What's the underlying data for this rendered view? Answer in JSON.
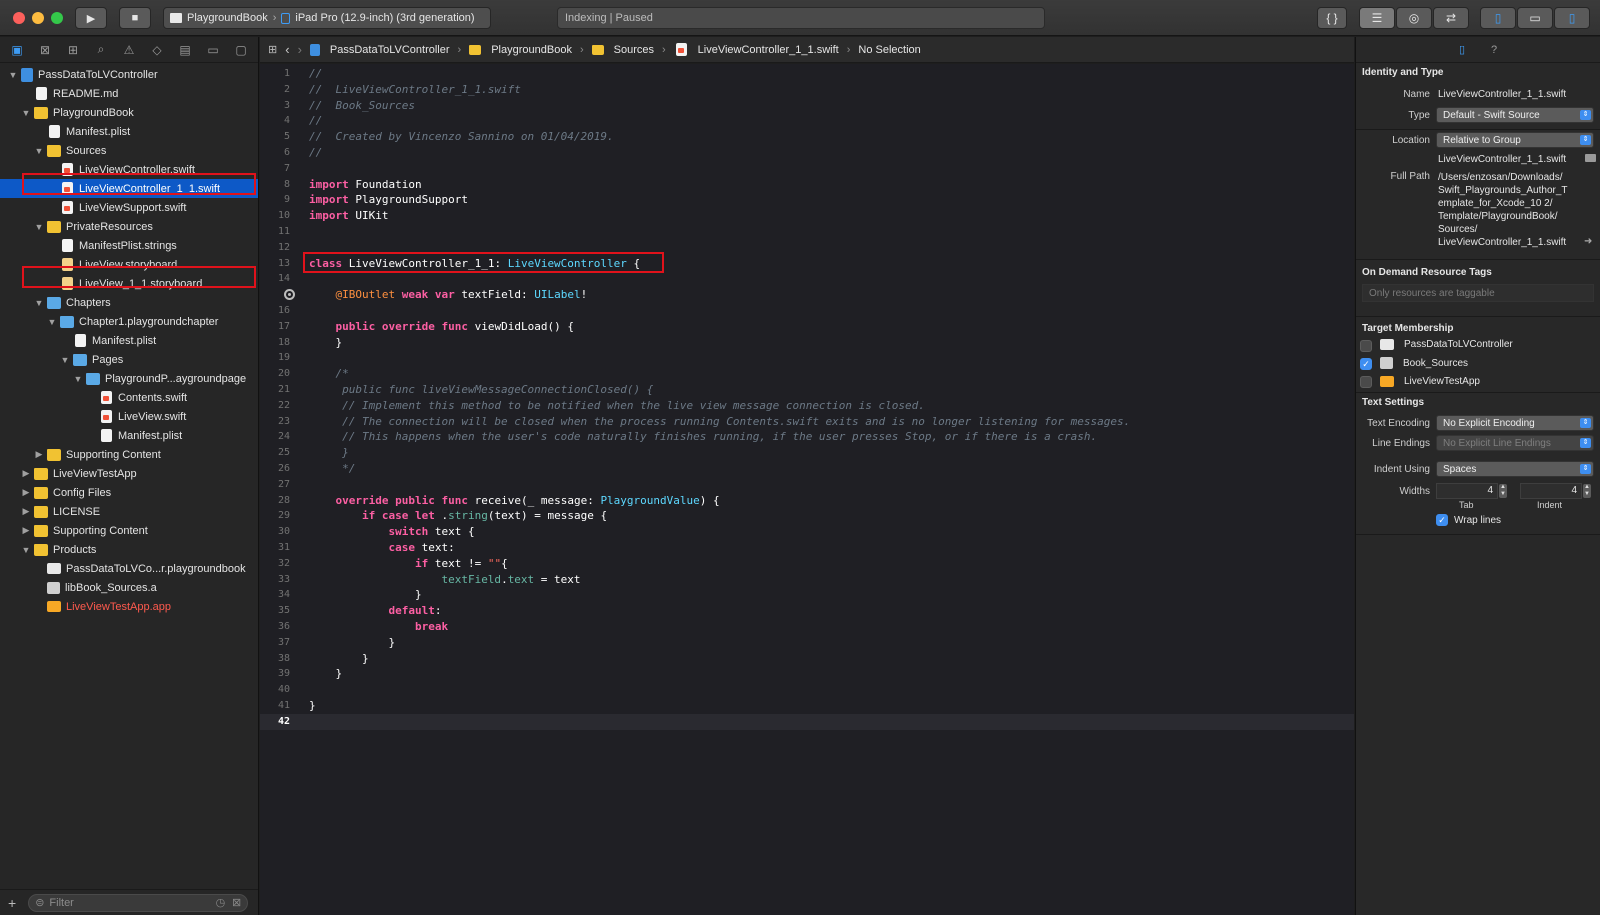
{
  "toolbar": {
    "scheme_name": "PlaygroundBook",
    "device_name": "iPad Pro (12.9-inch) (3rd generation)",
    "activity_status": "Indexing | Paused",
    "icons": [
      "play-icon",
      "stop-icon",
      "braces-icon",
      "standard-editor-icon",
      "assistant-editor-icon",
      "version-editor-icon",
      "left-panel-icon",
      "bottom-panel-icon",
      "right-panel-icon"
    ]
  },
  "navigator": {
    "tabs": [
      "folder-icon",
      "source-control-icon",
      "symbol-icon",
      "search-icon",
      "warning-icon",
      "test-icon",
      "debug-icon",
      "breakpoint-icon",
      "report-icon"
    ],
    "filter_placeholder": "Filter",
    "tree": [
      {
        "label": "PassDataToLVController",
        "depth": 0,
        "icon": "proj",
        "disc": "open"
      },
      {
        "label": "README.md",
        "depth": 1,
        "icon": "file",
        "disc": "none"
      },
      {
        "label": "PlaygroundBook",
        "depth": 1,
        "icon": "folder",
        "disc": "open"
      },
      {
        "label": "Manifest.plist",
        "depth": 2,
        "icon": "file",
        "disc": "none"
      },
      {
        "label": "Sources",
        "depth": 2,
        "icon": "folder",
        "disc": "open"
      },
      {
        "label": "LiveViewController.swift",
        "depth": 3,
        "icon": "swift",
        "disc": "none"
      },
      {
        "label": "LiveViewController_1_1.swift",
        "depth": 3,
        "icon": "swift",
        "disc": "none",
        "selected": true
      },
      {
        "label": "LiveViewSupport.swift",
        "depth": 3,
        "icon": "swift",
        "disc": "none"
      },
      {
        "label": "PrivateResources",
        "depth": 2,
        "icon": "folder",
        "disc": "open"
      },
      {
        "label": "ManifestPlist.strings",
        "depth": 3,
        "icon": "file",
        "disc": "none"
      },
      {
        "label": "LiveView.storyboard",
        "depth": 3,
        "icon": "story",
        "disc": "none"
      },
      {
        "label": "LiveView_1_1.storyboard",
        "depth": 3,
        "icon": "story",
        "disc": "none"
      },
      {
        "label": "Chapters",
        "depth": 2,
        "icon": "bluefolder",
        "disc": "open"
      },
      {
        "label": "Chapter1.playgroundchapter",
        "depth": 3,
        "icon": "bluefolder",
        "disc": "open"
      },
      {
        "label": "Manifest.plist",
        "depth": 4,
        "icon": "file",
        "disc": "none"
      },
      {
        "label": "Pages",
        "depth": 4,
        "icon": "bluefolder",
        "disc": "open"
      },
      {
        "label": "PlaygroundP...aygroundpage",
        "depth": 5,
        "icon": "bluefolder",
        "disc": "open"
      },
      {
        "label": "Contents.swift",
        "depth": 6,
        "icon": "swift",
        "disc": "none"
      },
      {
        "label": "LiveView.swift",
        "depth": 6,
        "icon": "swift",
        "disc": "none"
      },
      {
        "label": "Manifest.plist",
        "depth": 6,
        "icon": "file",
        "disc": "none"
      },
      {
        "label": "Supporting Content",
        "depth": 2,
        "icon": "folder",
        "disc": "closed"
      },
      {
        "label": "LiveViewTestApp",
        "depth": 1,
        "icon": "folder",
        "disc": "closed"
      },
      {
        "label": "Config Files",
        "depth": 1,
        "icon": "folder",
        "disc": "closed"
      },
      {
        "label": "LICENSE",
        "depth": 1,
        "icon": "folder",
        "disc": "closed"
      },
      {
        "label": "Supporting Content",
        "depth": 1,
        "icon": "folder",
        "disc": "closed"
      },
      {
        "label": "Products",
        "depth": 1,
        "icon": "folder",
        "disc": "open"
      },
      {
        "label": "PassDataToLVCo...r.playgroundbook",
        "depth": 2,
        "icon": "book",
        "disc": "none"
      },
      {
        "label": "libBook_Sources.a",
        "depth": 2,
        "icon": "lib",
        "disc": "none"
      },
      {
        "label": "LiveViewTestApp.app",
        "depth": 2,
        "icon": "app",
        "disc": "none",
        "red": true
      }
    ]
  },
  "jumpbar": {
    "crumbs": [
      "PassDataToLVController",
      "PlaygroundBook",
      "Sources",
      "LiveViewController_1_1.swift",
      "No Selection"
    ]
  },
  "editor": {
    "current_line": 42,
    "breakpoint_line": 15,
    "lines": [
      [
        [
          "c",
          "//"
        ]
      ],
      [
        [
          "c",
          "//  LiveViewController_1_1.swift"
        ]
      ],
      [
        [
          "c",
          "//  Book_Sources"
        ]
      ],
      [
        [
          "c",
          "//"
        ]
      ],
      [
        [
          "c",
          "//  Created by Vincenzo Sannino on 01/04/2019."
        ]
      ],
      [
        [
          "c",
          "//"
        ]
      ],
      [],
      [
        [
          "k",
          "import"
        ],
        [
          "p",
          " Foundation"
        ]
      ],
      [
        [
          "k",
          "import"
        ],
        [
          "p",
          " PlaygroundSupport"
        ]
      ],
      [
        [
          "k",
          "import"
        ],
        [
          "p",
          " UIKit"
        ]
      ],
      [],
      [],
      [
        [
          "k",
          "class"
        ],
        [
          "p",
          " LiveViewController_1_1: "
        ],
        [
          "t",
          "LiveViewController"
        ],
        [
          "p",
          " {"
        ]
      ],
      [],
      [
        [
          "p",
          "    "
        ],
        [
          "a",
          "@IBOutlet"
        ],
        [
          "p",
          " "
        ],
        [
          "k",
          "weak"
        ],
        [
          "p",
          " "
        ],
        [
          "k",
          "var"
        ],
        [
          "p",
          " textField: "
        ],
        [
          "t",
          "UILabel"
        ],
        [
          "p",
          "!"
        ]
      ],
      [],
      [
        [
          "p",
          "    "
        ],
        [
          "k",
          "public"
        ],
        [
          "p",
          " "
        ],
        [
          "k",
          "override"
        ],
        [
          "p",
          " "
        ],
        [
          "k",
          "func"
        ],
        [
          "p",
          " viewDidLoad() {"
        ]
      ],
      [
        [
          "p",
          "    }"
        ]
      ],
      [],
      [
        [
          "c",
          "    /*"
        ]
      ],
      [
        [
          "c",
          "     public func liveViewMessageConnectionClosed() {"
        ]
      ],
      [
        [
          "c",
          "     // Implement this method to be notified when the live view message connection is closed."
        ]
      ],
      [
        [
          "c",
          "     // The connection will be closed when the process running Contents.swift exits and is no longer listening for messages."
        ]
      ],
      [
        [
          "c",
          "     // This happens when the user's code naturally finishes running, if the user presses Stop, or if there is a crash."
        ]
      ],
      [
        [
          "c",
          "     }"
        ]
      ],
      [
        [
          "c",
          "     */"
        ]
      ],
      [],
      [
        [
          "p",
          "    "
        ],
        [
          "k",
          "override"
        ],
        [
          "p",
          " "
        ],
        [
          "k",
          "public"
        ],
        [
          "p",
          " "
        ],
        [
          "k",
          "func"
        ],
        [
          "p",
          " receive(_ message: "
        ],
        [
          "t",
          "PlaygroundValue"
        ],
        [
          "p",
          ") {"
        ]
      ],
      [
        [
          "p",
          "        "
        ],
        [
          "k",
          "if"
        ],
        [
          "p",
          " "
        ],
        [
          "k",
          "case"
        ],
        [
          "p",
          " "
        ],
        [
          "k",
          "let"
        ],
        [
          "p",
          " ."
        ],
        [
          "v",
          "string"
        ],
        [
          "p",
          "(text) = message {"
        ]
      ],
      [
        [
          "p",
          "            "
        ],
        [
          "k",
          "switch"
        ],
        [
          "p",
          " text {"
        ]
      ],
      [
        [
          "p",
          "            "
        ],
        [
          "k",
          "case"
        ],
        [
          "p",
          " text:"
        ]
      ],
      [
        [
          "p",
          "                "
        ],
        [
          "k",
          "if"
        ],
        [
          "p",
          " text != "
        ],
        [
          "s",
          "\"\""
        ],
        [
          "p",
          "{"
        ]
      ],
      [
        [
          "p",
          "                    "
        ],
        [
          "v",
          "textField"
        ],
        [
          "p",
          "."
        ],
        [
          "v",
          "text"
        ],
        [
          "p",
          " = text"
        ]
      ],
      [
        [
          "p",
          "                }"
        ]
      ],
      [
        [
          "p",
          "            "
        ],
        [
          "k",
          "default"
        ],
        [
          "p",
          ":"
        ]
      ],
      [
        [
          "p",
          "                "
        ],
        [
          "k",
          "break"
        ]
      ],
      [
        [
          "p",
          "            }"
        ]
      ],
      [
        [
          "p",
          "        }"
        ]
      ],
      [
        [
          "p",
          "    }"
        ]
      ],
      [],
      [
        [
          "p",
          "}"
        ]
      ],
      []
    ]
  },
  "inspector": {
    "tabs": [
      "file-inspector-icon",
      "help-icon"
    ],
    "identity_title": "Identity and Type",
    "name_label": "Name",
    "name_value": "LiveViewController_1_1.swift",
    "type_label": "Type",
    "type_value": "Default - Swift Source",
    "location_label": "Location",
    "location_value": "Relative to Group",
    "location_file": "LiveViewController_1_1.swift",
    "fullpath_label": "Full Path",
    "fullpath_lines": [
      "/Users/enzosan/Downloads/",
      "Swift_Playgrounds_Author_T",
      "emplate_for_Xcode_10 2/",
      "Template/PlaygroundBook/",
      "Sources/",
      "LiveViewController_1_1.swift"
    ],
    "odr_title": "On Demand Resource Tags",
    "odr_placeholder": "Only resources are taggable",
    "tm_title": "Target Membership",
    "targets": [
      {
        "label": "PassDataToLVController",
        "checked": false
      },
      {
        "label": "Book_Sources",
        "checked": true
      },
      {
        "label": "LiveViewTestApp",
        "checked": false
      }
    ],
    "ts_title": "Text Settings",
    "encoding_label": "Text Encoding",
    "encoding_value": "No Explicit Encoding",
    "endings_label": "Line Endings",
    "endings_value": "No Explicit Line Endings",
    "indent_label": "Indent Using",
    "indent_value": "Spaces",
    "widths_label": "Widths",
    "tab_width": "4",
    "indent_width": "4",
    "tab_caption": "Tab",
    "indent_caption": "Indent",
    "wrap_label": "Wrap lines",
    "wrap_checked": true
  },
  "colors": {
    "highlight_red": "#e0121b",
    "selection_blue": "#0d59c7",
    "keyword": "#fc5fa3",
    "type": "#5dd8ff",
    "comment": "#6c7986"
  }
}
